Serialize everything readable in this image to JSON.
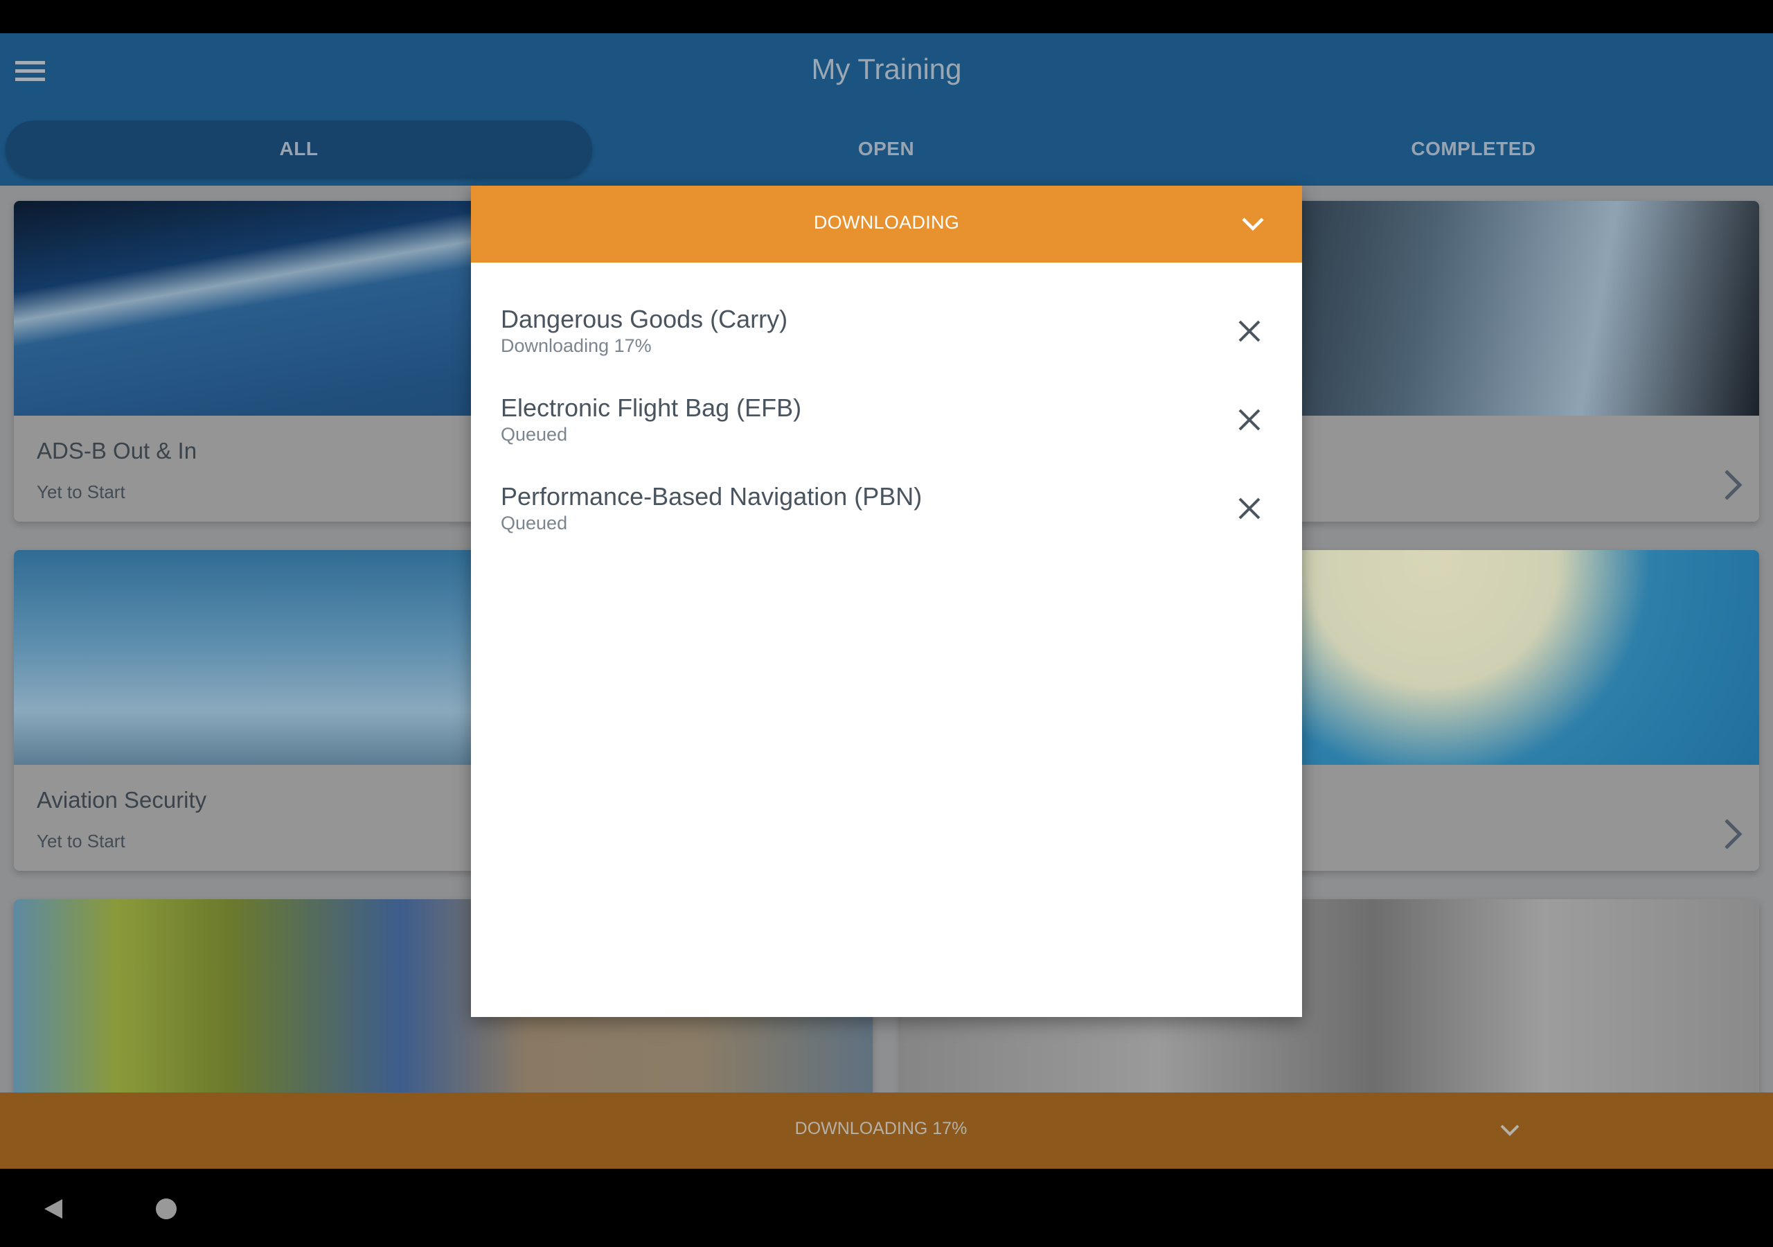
{
  "app_bar": {
    "title": "My Training",
    "menu_icon": "hamburger-menu-icon"
  },
  "tabs": [
    {
      "label": "ALL",
      "active": true
    },
    {
      "label": "OPEN",
      "active": false
    },
    {
      "label": "COMPLETED",
      "active": false
    }
  ],
  "courses": [
    {
      "title": "ADS-B Out & In",
      "status": "Yet to Start",
      "image": "satellite-earth-airplane"
    },
    {
      "title": "",
      "status": "",
      "image": "cockpit-life-vest"
    },
    {
      "title": "Aviation Security",
      "status": "Yet to Start",
      "image": "scandlearn-tail-pilot"
    },
    {
      "title": "",
      "status": "",
      "image": "airplane-sun"
    },
    {
      "title": "",
      "status": "",
      "image": "cargo-handler-boxes"
    },
    {
      "title": "",
      "status": "",
      "image": "efb-tablet-scale"
    }
  ],
  "download_modal": {
    "title": "DOWNLOADING",
    "collapse_icon": "chevron-down-icon",
    "items": [
      {
        "title": "Dangerous Goods (Carry)",
        "status": "Downloading 17%",
        "progress_percent": 17
      },
      {
        "title": "Electronic Flight Bag (EFB)",
        "status": "Queued"
      },
      {
        "title": "Performance-Based Navigation (PBN)",
        "status": "Queued"
      }
    ]
  },
  "bottom_bar": {
    "text": "DOWNLOADING 17%"
  },
  "colors": {
    "app_bar_blue": "#1b5481",
    "downloading_orange": "#e8912f"
  }
}
